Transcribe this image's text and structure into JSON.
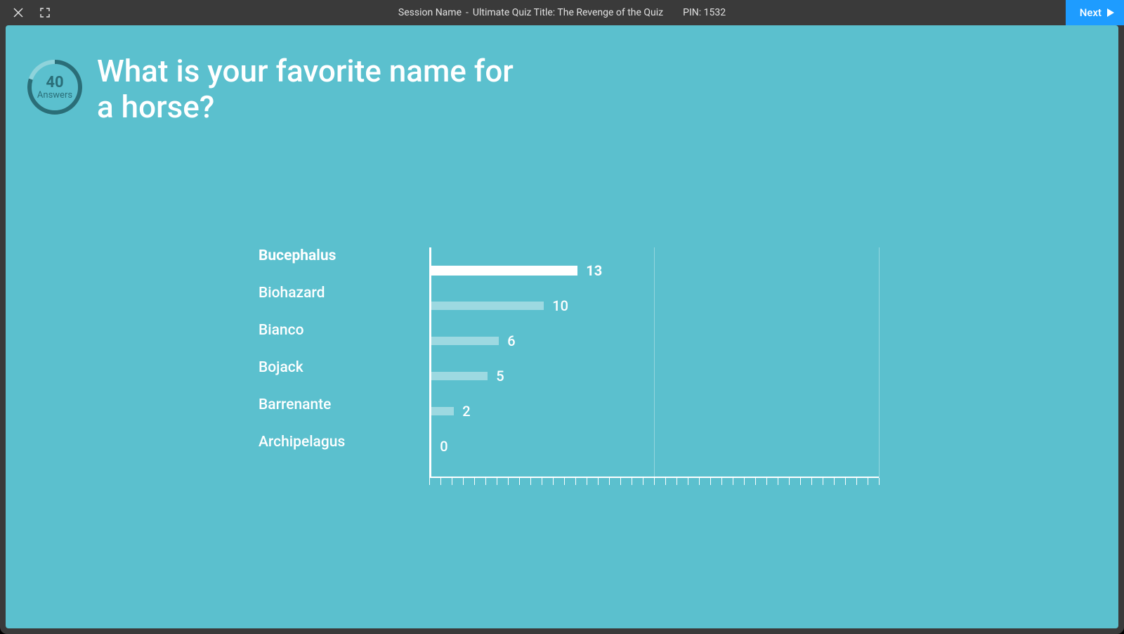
{
  "topbar": {
    "session_label": "Session Name",
    "separator": "-",
    "quiz_title": "Ultimate Quiz Title: The Revenge of the Quiz",
    "pin_label": "PIN: 1532",
    "next_label": "Next"
  },
  "counter": {
    "value": "40",
    "label": "Answers",
    "progress_pct": 80
  },
  "question": "What is your favorite name for a horse?",
  "chart_data": {
    "type": "bar",
    "title": "",
    "xlabel": "",
    "ylabel": "",
    "categories": [
      "Bucephalus",
      "Biohazard",
      "Bianco",
      "Bojack",
      "Barrenante",
      "Archipelagus"
    ],
    "values": [
      13,
      10,
      6,
      5,
      2,
      0
    ],
    "winner_index": 0,
    "xlim": [
      0,
      40
    ],
    "major_ticks": [
      0,
      20,
      40
    ],
    "minor_tick_step": 1
  },
  "colors": {
    "stage_bg": "#5bc0ce",
    "bar": "#9dd9e1",
    "bar_winner": "#ffffff",
    "next_btn": "#1e9cff"
  }
}
